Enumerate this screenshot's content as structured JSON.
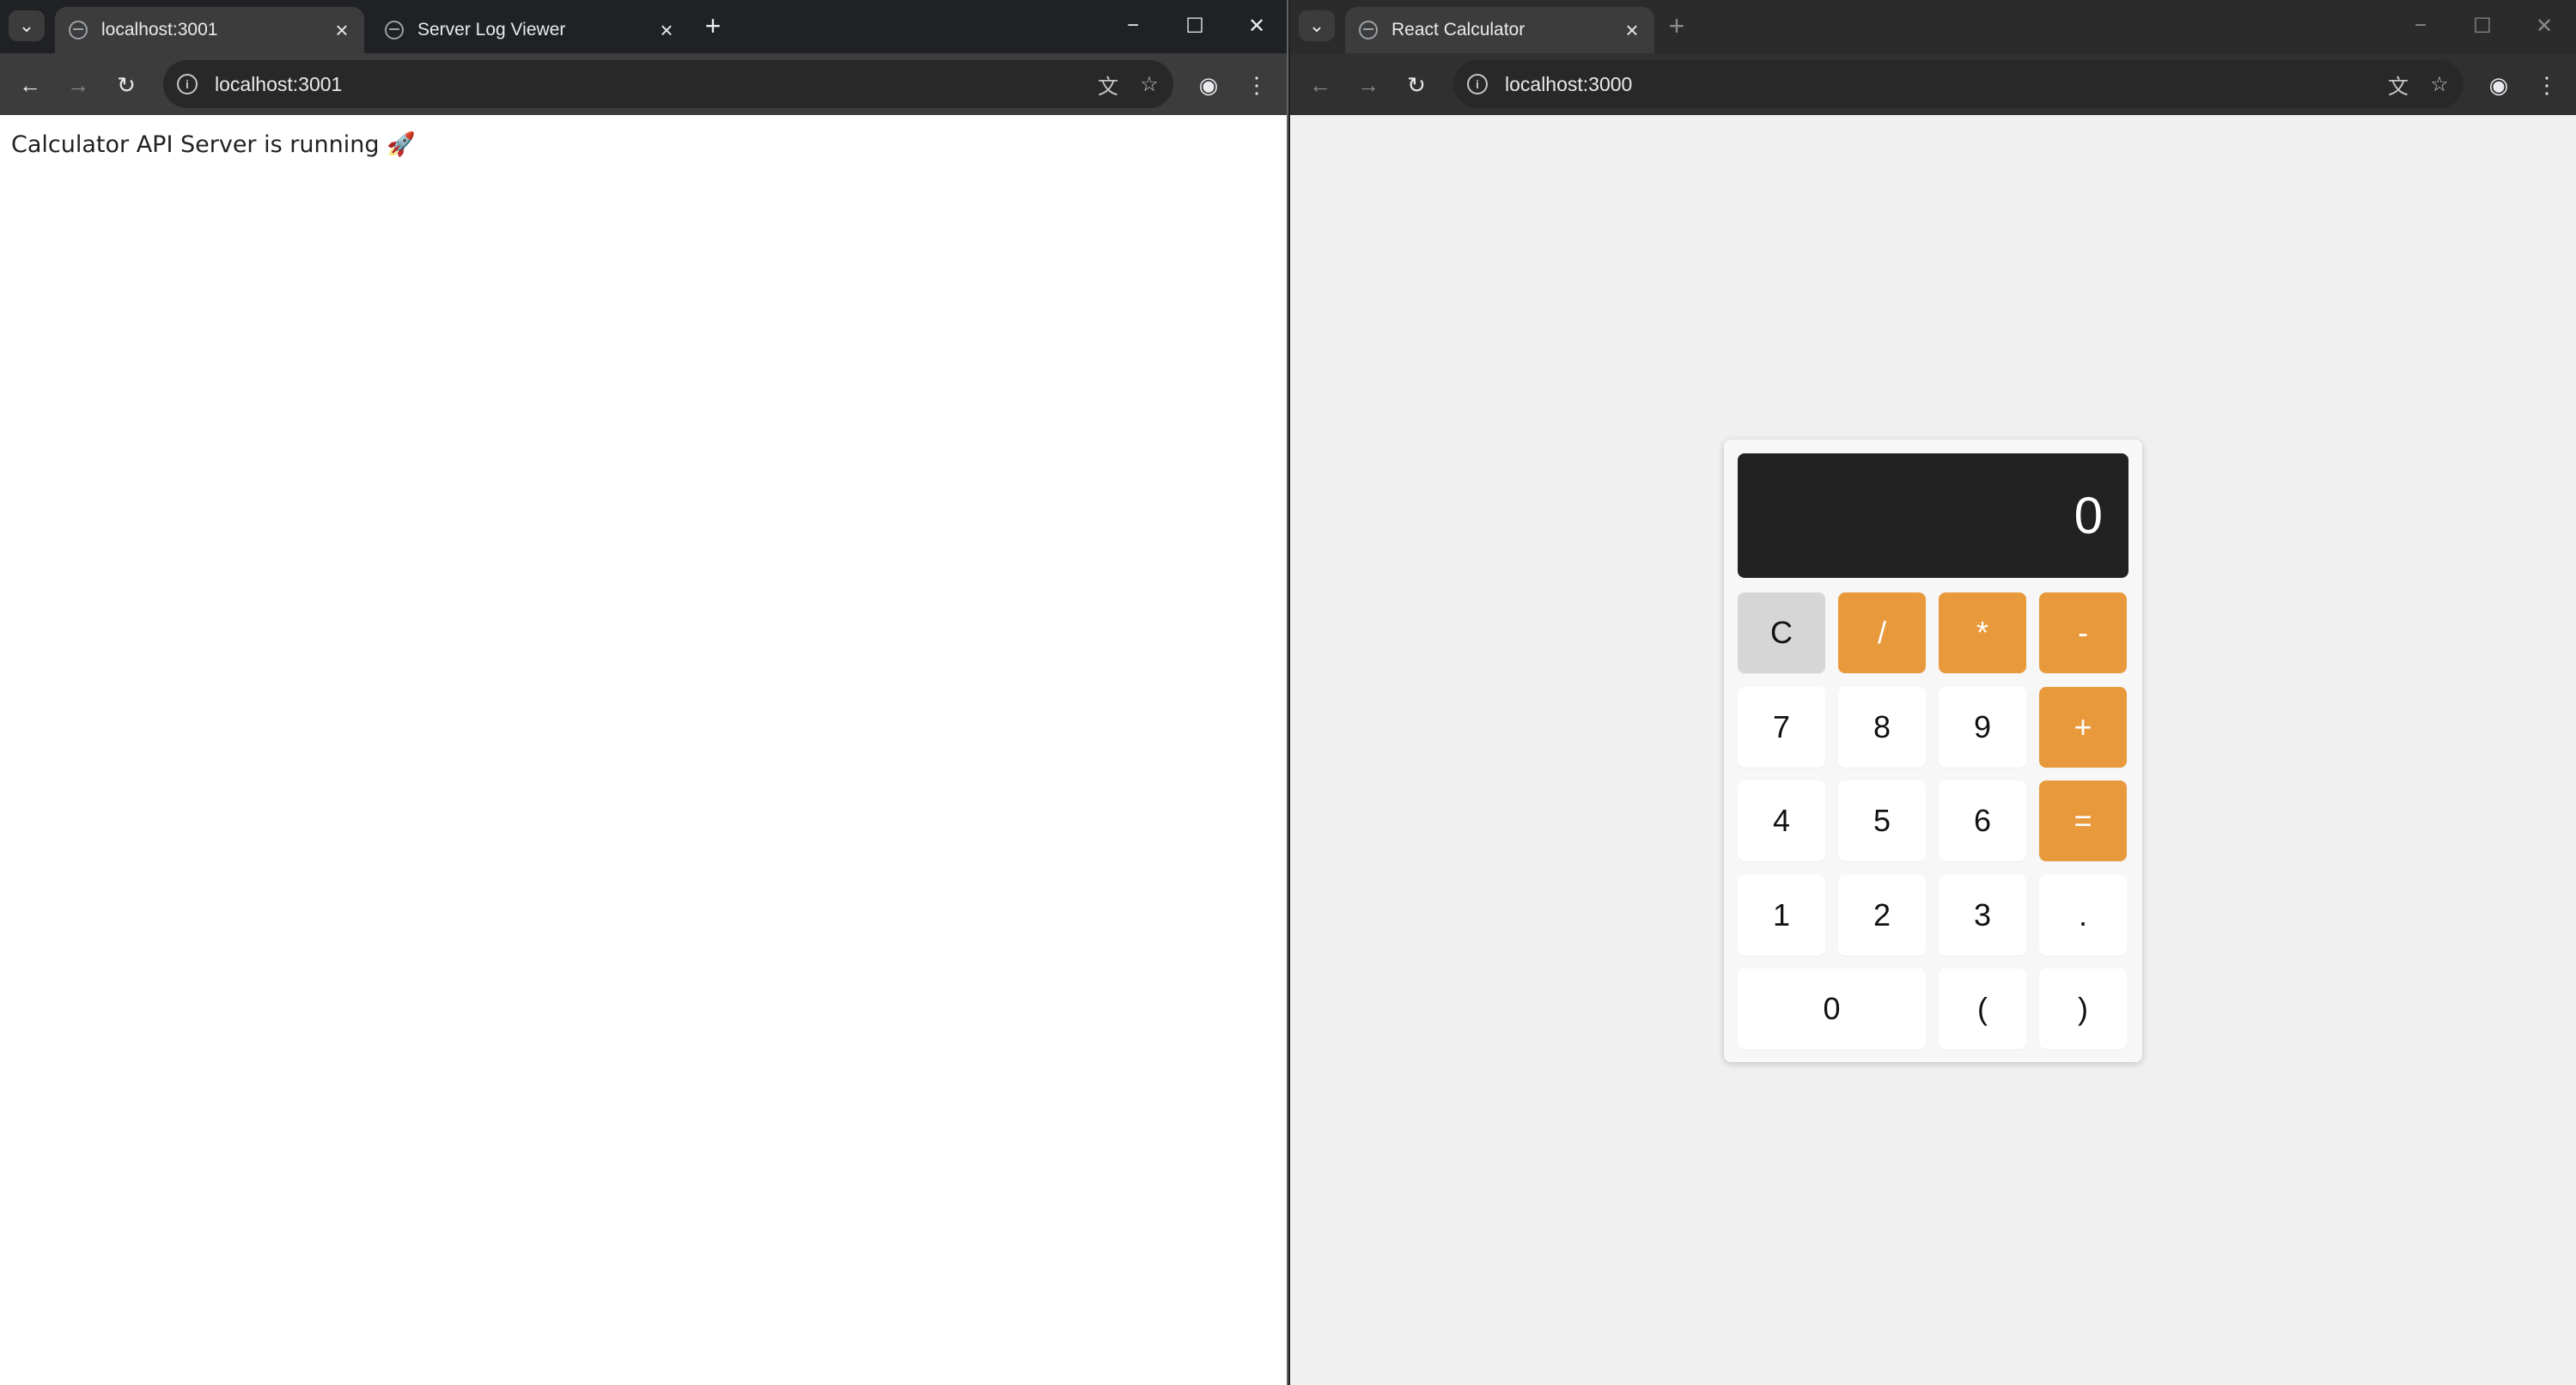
{
  "left_window": {
    "tabs": [
      {
        "title": "localhost:3001",
        "active": true
      },
      {
        "title": "Server Log Viewer",
        "active": false
      }
    ],
    "address": "localhost:3001",
    "page_text": "Calculator API Server is running 🚀"
  },
  "right_window": {
    "tabs": [
      {
        "title": "React Calculator",
        "active": true
      }
    ],
    "address": "localhost:3000",
    "calculator": {
      "display": "0",
      "buttons": {
        "clear": "C",
        "divide": "/",
        "multiply": "*",
        "minus": "-",
        "seven": "7",
        "eight": "8",
        "nine": "9",
        "plus": "+",
        "four": "4",
        "five": "5",
        "six": "6",
        "equals": "=",
        "one": "1",
        "two": "2",
        "three": "3",
        "dot": ".",
        "zero": "0",
        "lparen": "(",
        "rparen": ")"
      }
    }
  },
  "icons": {
    "tab_search": "chevron-down-icon",
    "new_tab": "plus-icon",
    "back": "arrow-left-icon",
    "forward": "arrow-right-icon",
    "reload": "reload-icon",
    "translate": "translate-icon",
    "bookmark": "star-icon",
    "profile": "profile-icon",
    "menu": "kebab-menu-icon"
  },
  "colors": {
    "operator": "#e8993c",
    "display_bg": "#222222",
    "clear_bg": "#d6d6d6"
  }
}
